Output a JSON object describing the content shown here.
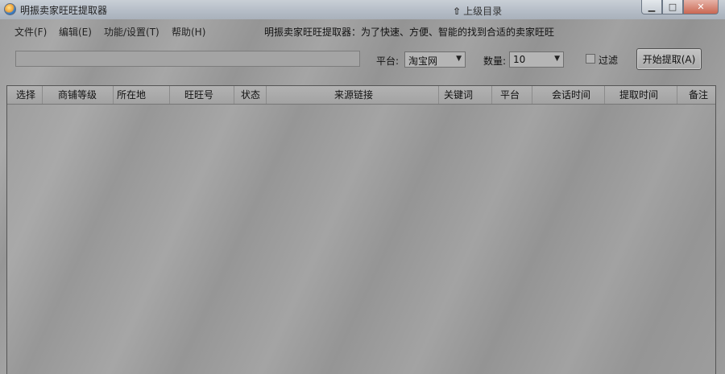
{
  "window": {
    "title": "明振卖家旺旺提取器",
    "background_text": "",
    "folder_up_label": "上级目录"
  },
  "menu": {
    "items": [
      "文件(F)",
      "编辑(E)",
      "功能/设置(T)",
      "帮助(H)"
    ],
    "slogan": "明振卖家旺旺提取器：为了快速、方便、智能的找到合适的卖家旺旺"
  },
  "toolbar": {
    "url_value": "",
    "platform_label": "平台:",
    "platform_value": "淘宝网",
    "count_label": "数量:",
    "count_value": "10",
    "filter_label": "过滤",
    "filter_checked": false,
    "start_button": "开始提取(A)"
  },
  "table": {
    "columns": [
      "选择",
      "商铺等级",
      "所在地",
      "旺旺号",
      "状态",
      "来源链接",
      "关键词",
      "平台",
      "会话时间",
      "提取时间",
      "备注"
    ],
    "rows": []
  },
  "icons": {
    "app": "app-globe-icon",
    "folder_up": "arrow-up-icon",
    "minimize": "minimize-icon",
    "maximize": "maximize-icon",
    "close": "close-icon",
    "dropdown": "chevron-down-icon"
  }
}
